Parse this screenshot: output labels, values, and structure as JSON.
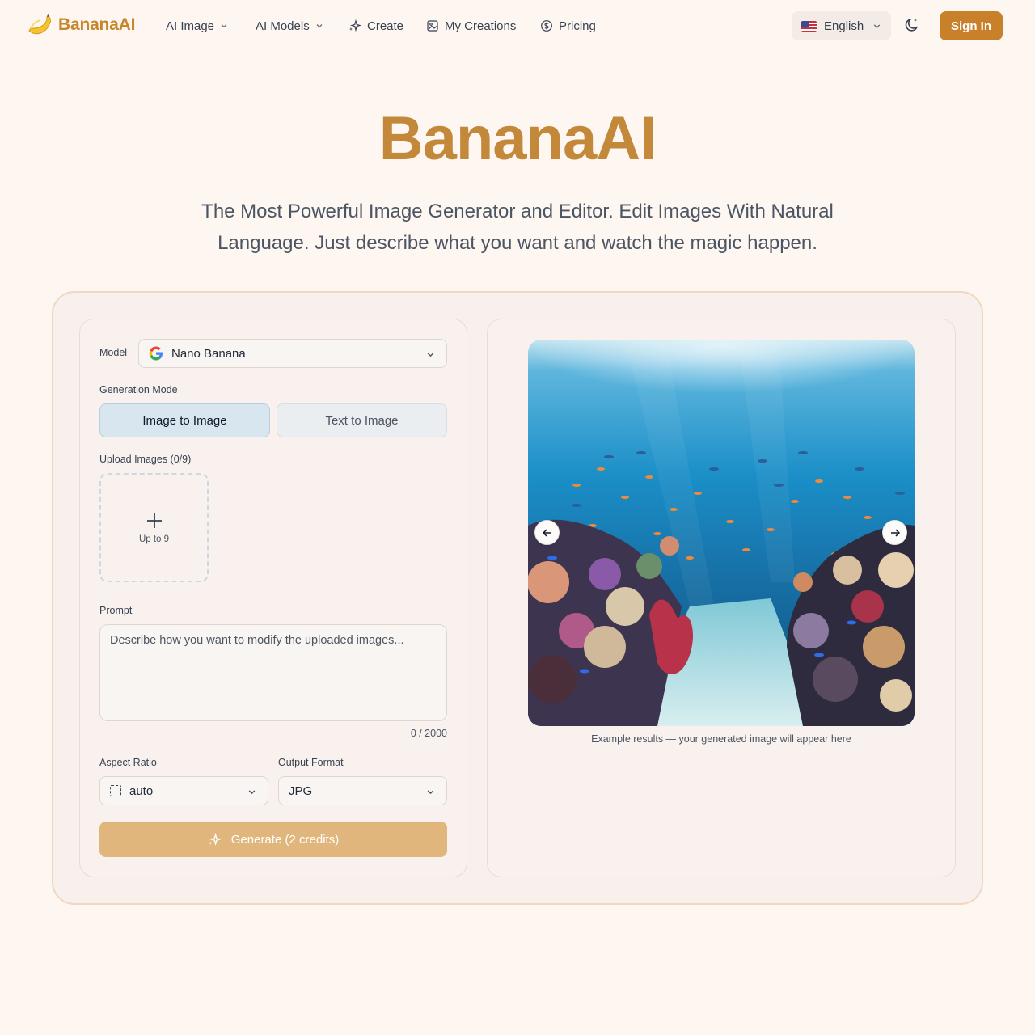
{
  "brand": {
    "name": "BananaAI",
    "accent": "#c8812a"
  },
  "nav": {
    "items": [
      {
        "label": "AI Image",
        "icon": "chevron-down-icon"
      },
      {
        "label": "AI Models",
        "icon": "chevron-down-icon"
      },
      {
        "label": "Create",
        "icon": "sparkles-icon"
      },
      {
        "label": "My Creations",
        "icon": "image-icon"
      },
      {
        "label": "Pricing",
        "icon": "dollar-circle-icon"
      }
    ],
    "language": "English",
    "theme_icon": "moon-icon",
    "sign_in": "Sign In"
  },
  "hero": {
    "title": "BananaAI",
    "subtitle": "The Most Powerful Image Generator and Editor. Edit Images With Natural Language. Just describe what you want and watch the magic happen."
  },
  "form": {
    "model_label": "Model",
    "model_value": "Nano Banana",
    "mode_label": "Generation Mode",
    "modes": [
      {
        "label": "Image to Image",
        "active": true
      },
      {
        "label": "Text to Image",
        "active": false
      }
    ],
    "upload_label": "Upload Images (0/9)",
    "upload_hint": "Up to 9",
    "prompt_label": "Prompt",
    "prompt_placeholder": "Describe how you want to modify the uploaded images...",
    "prompt_counter": "0 / 2000",
    "aspect_label": "Aspect Ratio",
    "aspect_value": "auto",
    "format_label": "Output Format",
    "format_value": "JPG",
    "generate_label": "Generate (2 credits)"
  },
  "preview": {
    "image_subject": "underwater-coral-reef",
    "caption": "Example results — your generated image will appear here"
  }
}
